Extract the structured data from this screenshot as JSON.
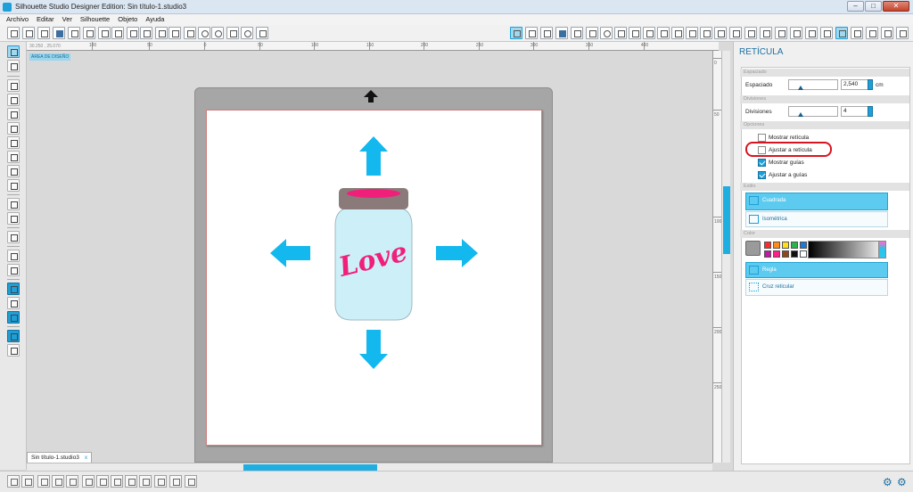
{
  "window": {
    "title": "Silhouette Studio Designer Edition: Sin título-1.studio3"
  },
  "menu": [
    "Archivo",
    "Editar",
    "Ver",
    "Silhouette",
    "Objeto",
    "Ayuda"
  ],
  "ruler": {
    "h_ticks": [
      "100",
      "50",
      "0",
      "50",
      "100",
      "150",
      "200",
      "250",
      "300",
      "350",
      "400"
    ],
    "v_ticks": [
      "0",
      "50",
      "100",
      "150",
      "200",
      "250"
    ],
    "coords": "30.250 , 25.070"
  },
  "canvas": {
    "design_label": "ÁREA DE DISEÑO",
    "love_text": "Love"
  },
  "doc_tab": {
    "name": "Sin título-1.studio3",
    "close": "x"
  },
  "panel": {
    "title": "RETÍCULA",
    "sections": {
      "spacing": "Espaciado",
      "divisions": "Divisiones",
      "options": "Opciones",
      "style": "Estilo",
      "color": "Color"
    },
    "spacing_label": "Espaciado",
    "spacing_value": "2,540",
    "spacing_unit": "cm",
    "spacing_slider": 0.18,
    "divisions_label": "Divisiones",
    "divisions_value": "4",
    "divisions_slider": 0.18,
    "options": [
      {
        "label": "Mostrar retícula",
        "checked": false
      },
      {
        "label": "Ajustar a retícula",
        "checked": false
      },
      {
        "label": "Mostrar guías",
        "checked": true
      },
      {
        "label": "Ajustar a guías",
        "checked": true
      }
    ],
    "style_options": [
      "Cuadrada",
      "Isométrica"
    ],
    "selected_style": "Cuadrada",
    "line_options": [
      "Regla",
      "Cruz reticular"
    ],
    "selected_line": "Regla"
  },
  "colors": {
    "accent": "#1e9fd8",
    "arrow": "#12b8ee",
    "jar_lid": "#8a7a7a",
    "jar_glass": "#cdf0f8",
    "love": "#f0207a",
    "highlight": "#d8141e",
    "swatches": [
      "#ff2a2a",
      "#ff8c1a",
      "#ffe01a",
      "#2ab34a",
      "#1e78d8",
      "#c01aa8",
      "#ff1f8a",
      "#8a4a1a",
      "#111111",
      "#ffffff"
    ]
  }
}
